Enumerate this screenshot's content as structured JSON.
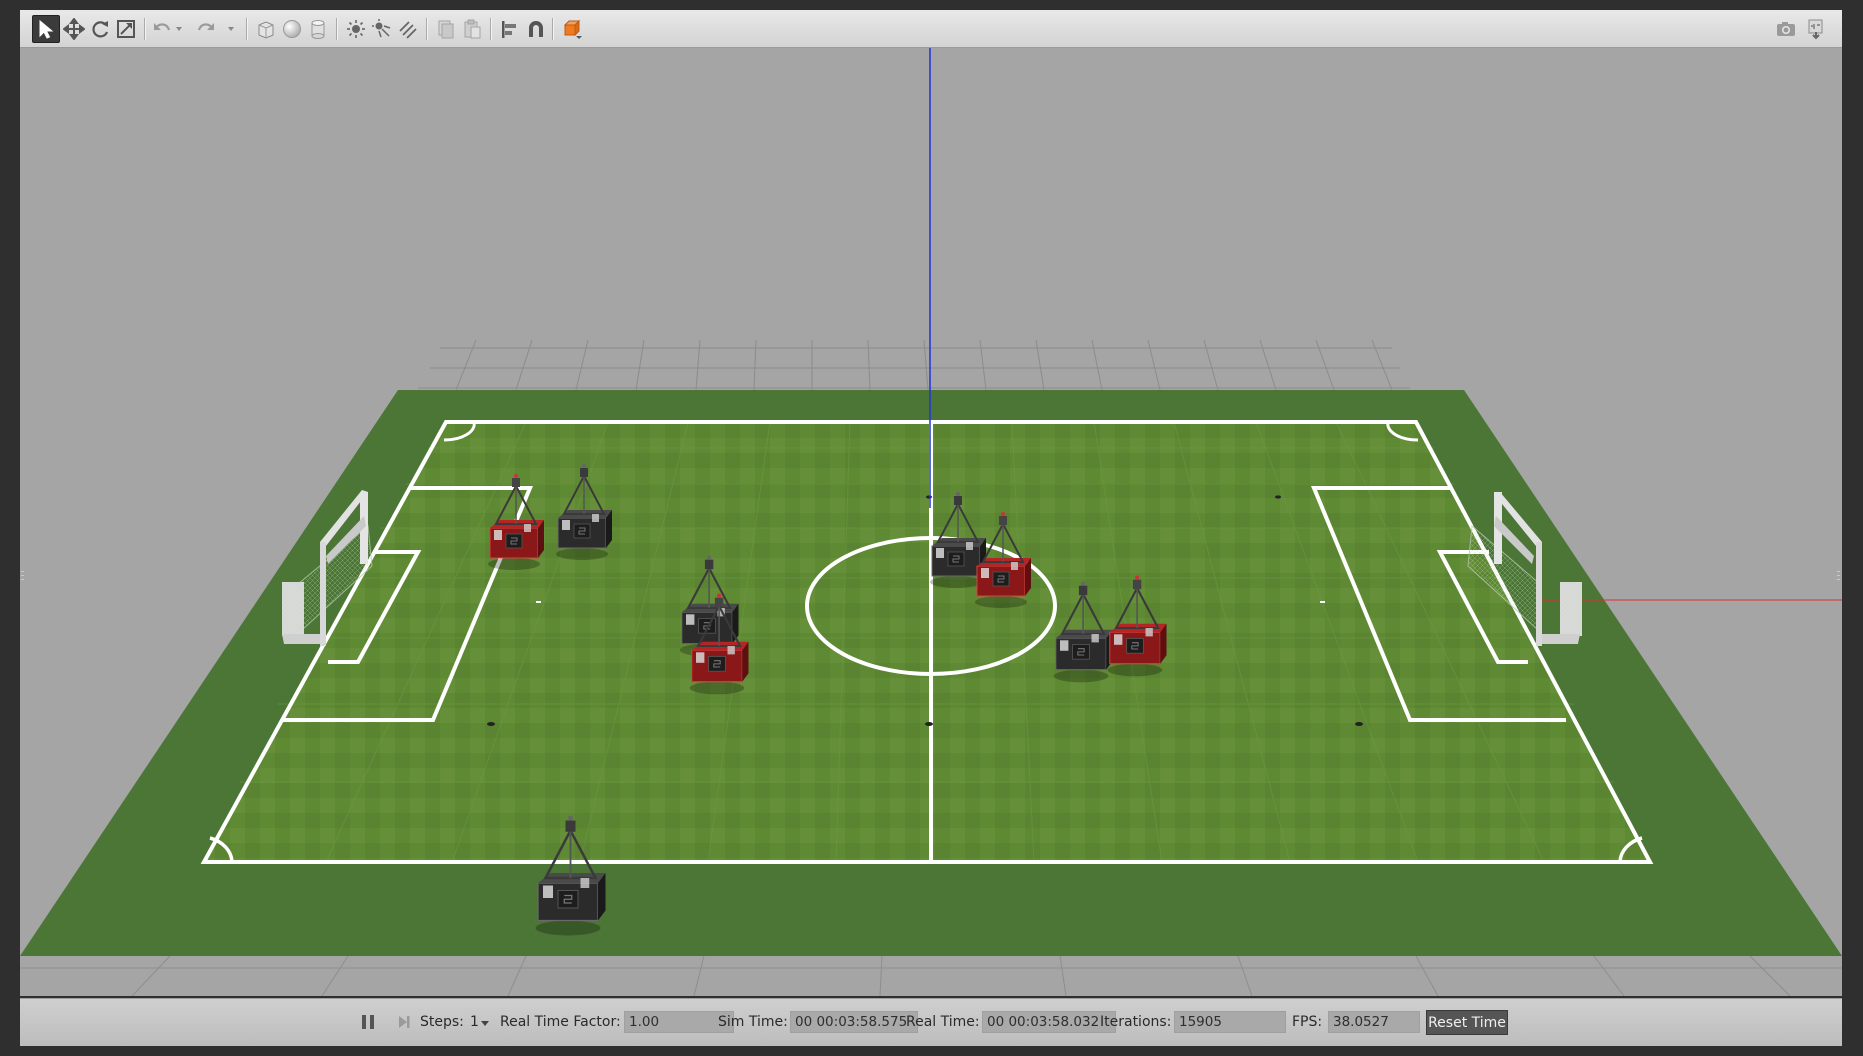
{
  "toolbar": {
    "left_icons": [
      "select-arrow-icon",
      "translate-icon",
      "rotate-icon",
      "scale-icon",
      "undo-icon",
      "undo-history-icon",
      "redo-icon",
      "redo-history-icon",
      "box-icon",
      "sphere-icon",
      "cylinder-icon",
      "point-light-icon",
      "spot-light-icon",
      "directional-light-icon",
      "copy-icon",
      "paste-icon",
      "align-icon",
      "snap-icon",
      "view-angle-icon"
    ],
    "right_icons": [
      "screenshot-icon",
      "log-icon"
    ],
    "active_tool": "select-arrow-icon",
    "accent": "#f07a1f"
  },
  "bottombar": {
    "steps_label": "Steps:",
    "steps_value": "1",
    "rtf_label": "Real Time Factor:",
    "rtf_value": "1.00",
    "sim_label": "Sim Time:",
    "sim_value": "00 00:03:58.575",
    "real_label": "Real Time:",
    "real_value": "00 00:03:58.032",
    "iter_label": "Iterations:",
    "iter_value": "15905",
    "fps_label": "FPS:",
    "fps_value": "38.0527",
    "reset_label": "Reset Time"
  },
  "scene": {
    "grass_color": "#5f8b35",
    "border_color": "#4b7635",
    "axis_z_color": "#2233dd",
    "axis_x_color": "#dd3333",
    "robots": [
      {
        "id": "robot-red-1",
        "team": "red"
      },
      {
        "id": "robot-black-1",
        "team": "black"
      },
      {
        "id": "robot-black-2",
        "team": "black"
      },
      {
        "id": "robot-red-2",
        "team": "red"
      },
      {
        "id": "robot-black-3",
        "team": "black"
      },
      {
        "id": "robot-red-3",
        "team": "red"
      },
      {
        "id": "robot-black-4",
        "team": "black"
      },
      {
        "id": "robot-red-4",
        "team": "red"
      },
      {
        "id": "robot-black-5",
        "team": "black"
      }
    ]
  }
}
